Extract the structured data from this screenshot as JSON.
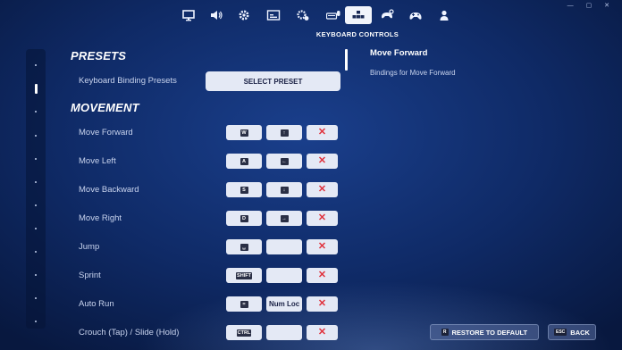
{
  "window_controls": "— ▢ ✕",
  "top_nav": {
    "tabs": [
      {
        "icon": "monitor-icon"
      },
      {
        "icon": "speaker-icon"
      },
      {
        "icon": "gear-icon"
      },
      {
        "icon": "subtitles-icon"
      },
      {
        "icon": "accessibility-gear-icon"
      },
      {
        "icon": "keyboard-mouse-icon"
      },
      {
        "icon": "keyboard-controls-icon",
        "active": true
      },
      {
        "icon": "controller-gear-icon"
      },
      {
        "icon": "gamepad-icon"
      },
      {
        "icon": "account-icon"
      }
    ],
    "active_title": "KEYBOARD CONTROLS"
  },
  "presets": {
    "heading": "PRESETS",
    "label": "Keyboard Binding Presets",
    "button": "SELECT PRESET"
  },
  "movement": {
    "heading": "MOVEMENT",
    "rows": [
      {
        "label": "Move Forward",
        "primary": "W",
        "secondary": "↑",
        "remove": "✕"
      },
      {
        "label": "Move Left",
        "primary": "A",
        "secondary": "←",
        "remove": "✕"
      },
      {
        "label": "Move Backward",
        "primary": "S",
        "secondary": "↓",
        "remove": "✕"
      },
      {
        "label": "Move Right",
        "primary": "D",
        "secondary": "→",
        "remove": "✕"
      },
      {
        "label": "Jump",
        "primary": "␣",
        "secondary": "",
        "remove": "✕"
      },
      {
        "label": "Sprint",
        "primary": "SHIFT",
        "secondary": "",
        "remove": "✕"
      },
      {
        "label": "Auto Run",
        "primary": "=",
        "secondary_text": "Num Lock",
        "remove": "✕"
      },
      {
        "label": "Crouch (Tap) / Slide (Hold)",
        "primary": "CTRL",
        "secondary": "",
        "remove": "✕"
      }
    ]
  },
  "description": {
    "title": "Move Forward",
    "body": "Bindings for Move Forward"
  },
  "bottom_buttons": {
    "restore": {
      "key": "R",
      "label": "RESTORE TO DEFAULT"
    },
    "back": {
      "key": "ESC",
      "label": "BACK"
    }
  },
  "colors": {
    "background": "#0f2a66",
    "button_fill": "#e4e9f5",
    "remove_x": "#e0313c"
  }
}
